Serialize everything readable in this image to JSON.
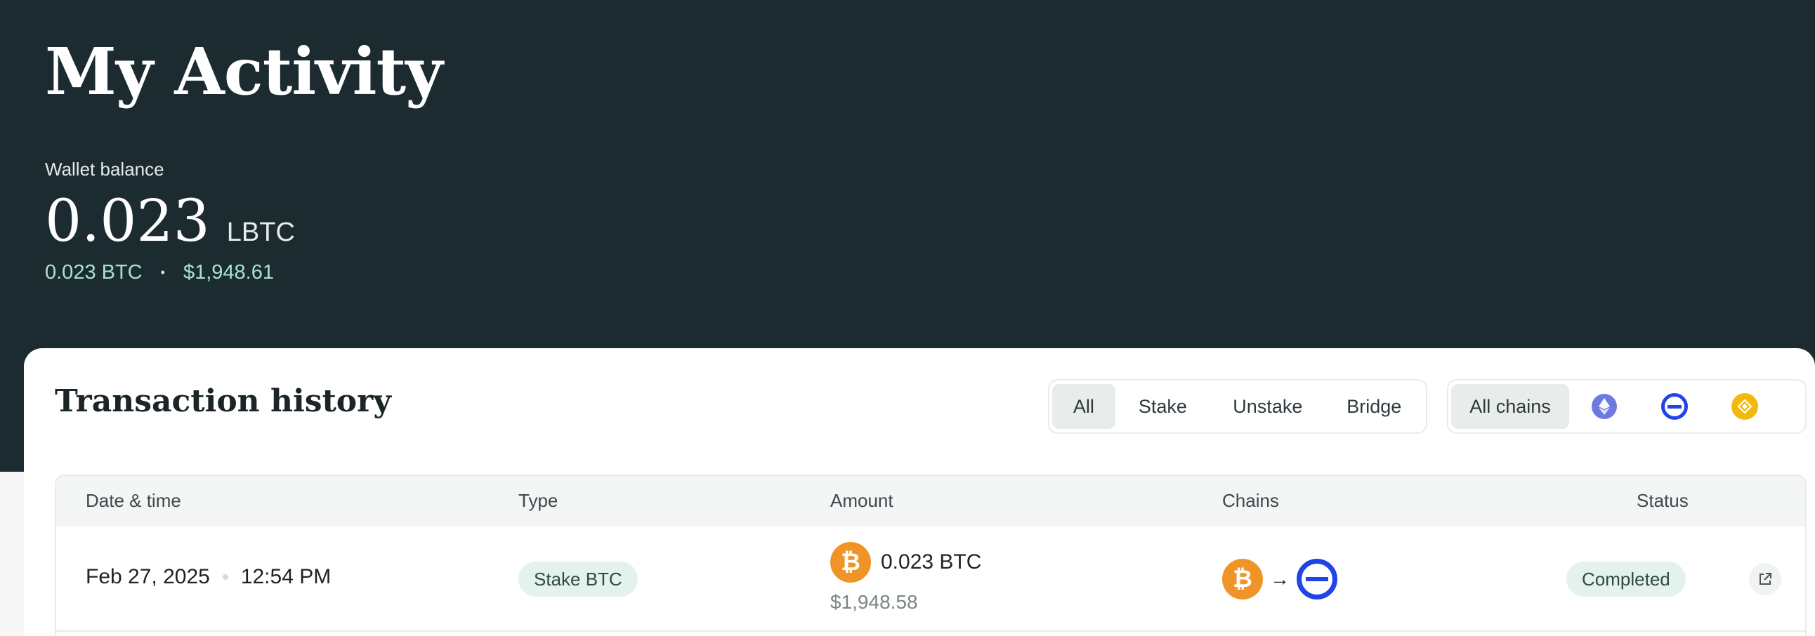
{
  "header": {
    "title": "My Activity",
    "balance_label": "Wallet balance",
    "balance_value": "0.023",
    "balance_unit": "LBTC",
    "balance_btc": "0.023 BTC",
    "balance_separator": "•",
    "balance_usd": "$1,948.61"
  },
  "history": {
    "title": "Transaction history",
    "type_filters": [
      "All",
      "Stake",
      "Unstake",
      "Bridge"
    ],
    "active_type_filter": "All",
    "chain_filters": {
      "all_label": "All chains",
      "icons": [
        "ethereum-icon",
        "base-icon",
        "bnb-icon"
      ]
    },
    "columns": [
      "Date & time",
      "Type",
      "Amount",
      "Chains",
      "Status"
    ],
    "rows": [
      {
        "date": "Feb 27, 2025",
        "time": "12:54 PM",
        "type": "Stake BTC",
        "amount": "0.023 BTC",
        "amount_usd": "$1,948.58",
        "chain_from": "bitcoin-icon",
        "chain_arrow": "→",
        "chain_to": "base-icon",
        "status": "Completed"
      }
    ]
  },
  "colors": {
    "hero_bg": "#1c2b30",
    "accent_mint": "#a6e3d6",
    "pill_bg": "#e4f2ee",
    "bitcoin": "#f09428",
    "base": "#2144e8",
    "ethereum": "#6f7ae0",
    "bnb": "#f0b90b"
  }
}
